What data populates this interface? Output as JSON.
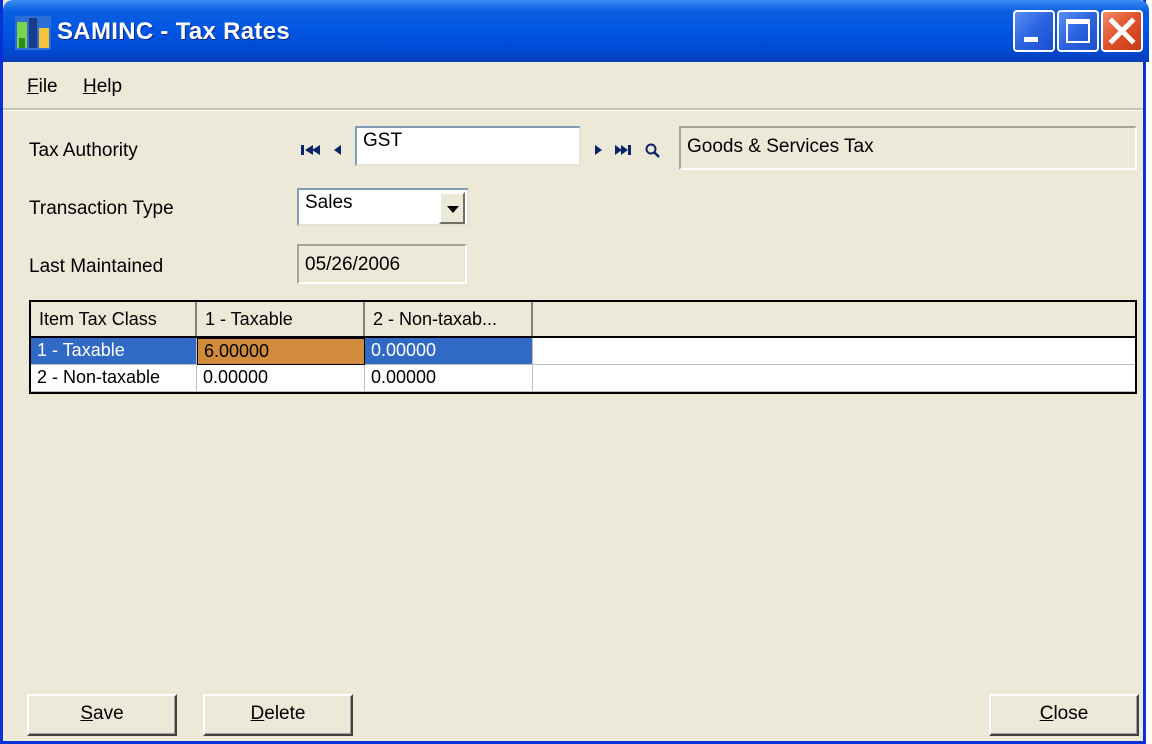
{
  "window": {
    "title": "SAMINC - Tax Rates",
    "icon": "app-building-icon"
  },
  "menu": {
    "file_u": "F",
    "file_rest": "ile",
    "help_u": "H",
    "help_rest": "elp"
  },
  "form": {
    "tax_authority_label": "Tax Authority",
    "tax_authority_value": "GST",
    "tax_authority_desc": "Goods & Services Tax",
    "transaction_type_label": "Transaction Type",
    "transaction_type_value": "Sales",
    "last_maintained_label": "Last Maintained",
    "last_maintained_value": "05/26/2006"
  },
  "grid": {
    "headers": [
      "Item Tax Class",
      "1 - Taxable",
      "2 - Non-taxab..."
    ],
    "rows": [
      [
        "1 - Taxable",
        "6.00000",
        "0.00000"
      ],
      [
        "2 - Non-taxable",
        "0.00000",
        "0.00000"
      ]
    ]
  },
  "buttons": {
    "save_u": "S",
    "save_rest": "ave",
    "delete_u": "D",
    "delete_rest": "elete",
    "close_u": "C",
    "close_rest": "lose"
  }
}
